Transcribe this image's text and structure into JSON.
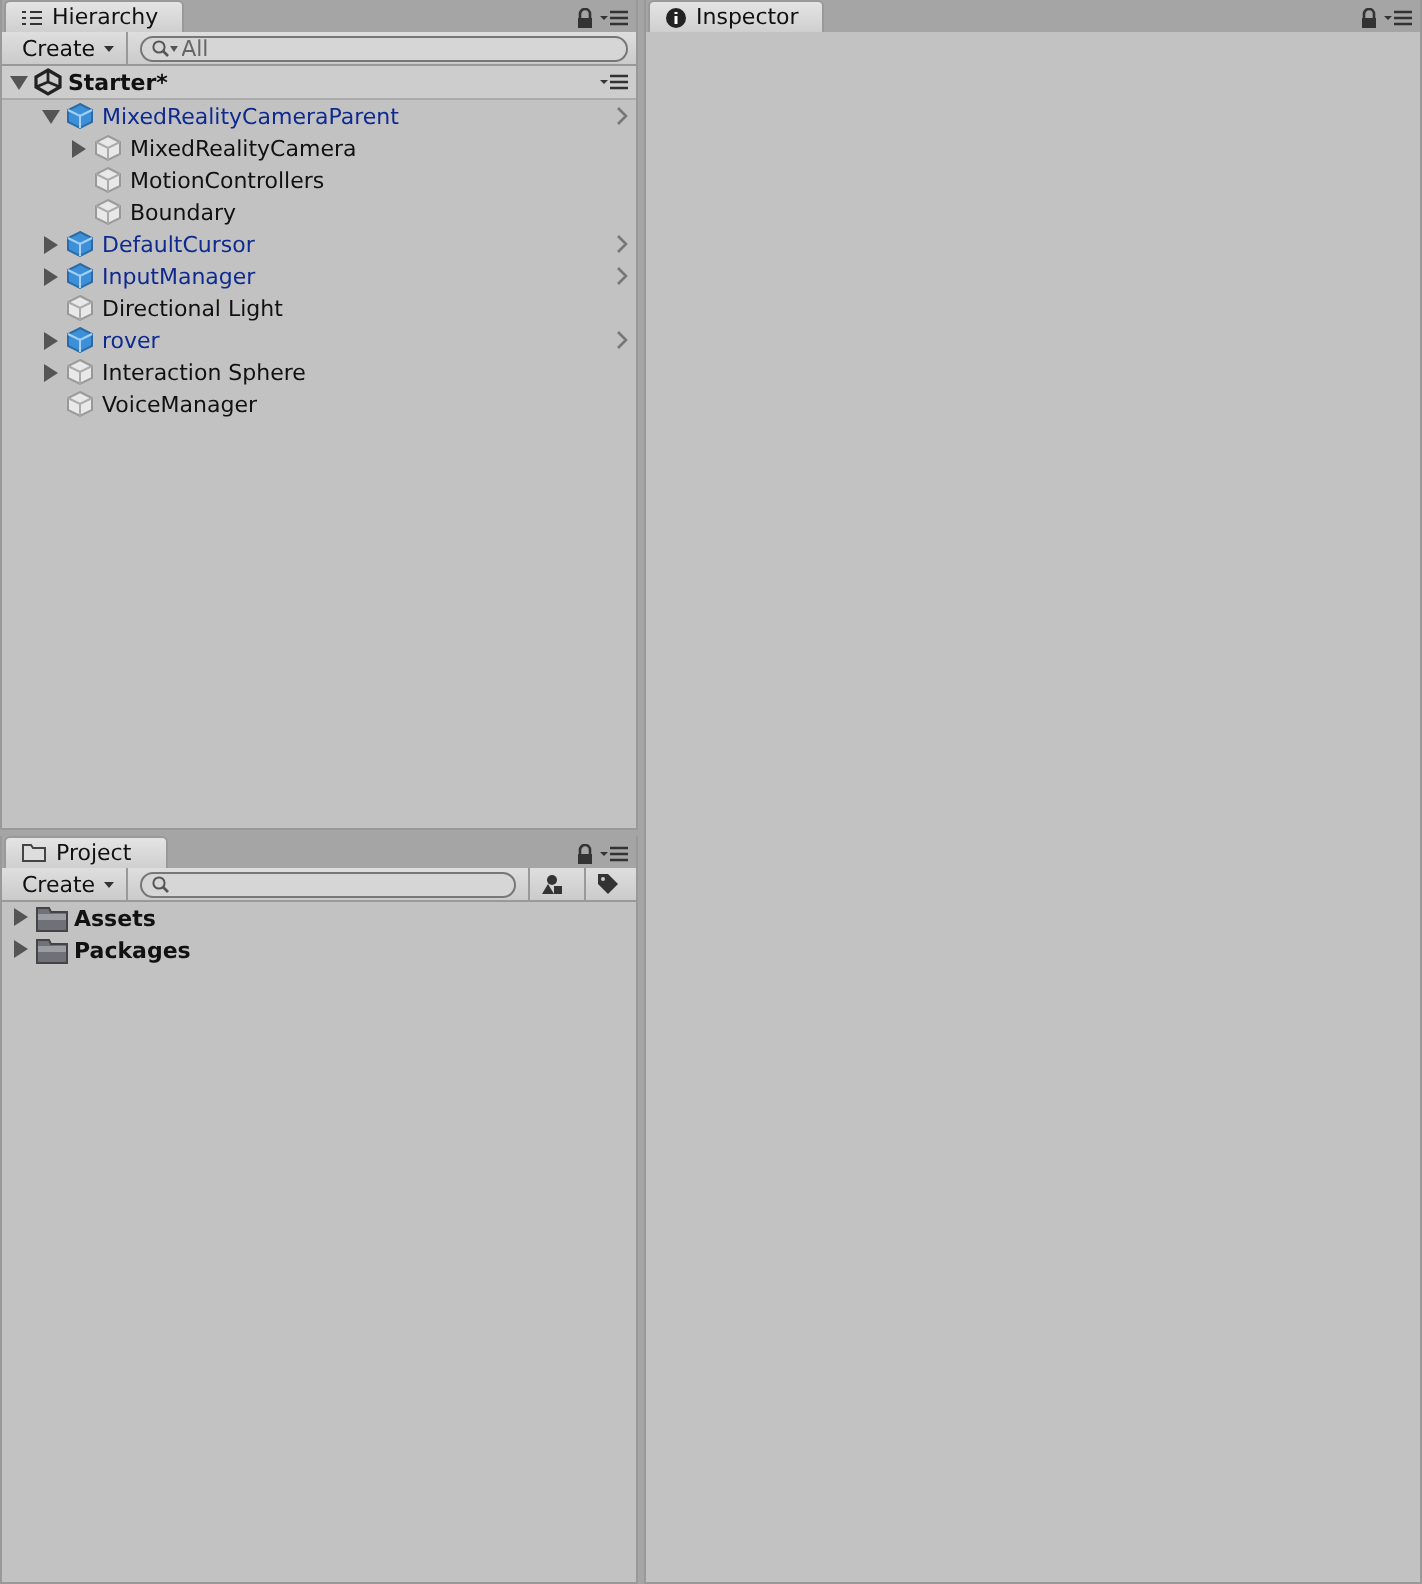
{
  "hierarchy": {
    "tab": "Hierarchy",
    "create": "Create",
    "search": {
      "placeholder": "All"
    },
    "scene": "Starter*",
    "items": [
      {
        "name": "MixedRealityCameraParent",
        "kind": "prefab",
        "expandable": true,
        "expanded": true,
        "children": [
          {
            "name": "MixedRealityCamera",
            "kind": "object",
            "expandable": true,
            "expanded": false
          },
          {
            "name": "MotionControllers",
            "kind": "object",
            "expandable": false,
            "expanded": false
          },
          {
            "name": "Boundary",
            "kind": "object",
            "expandable": false,
            "expanded": false
          }
        ]
      },
      {
        "name": "DefaultCursor",
        "kind": "prefab",
        "expandable": true,
        "expanded": false
      },
      {
        "name": "InputManager",
        "kind": "prefab",
        "expandable": true,
        "expanded": false
      },
      {
        "name": "Directional Light",
        "kind": "object",
        "expandable": false,
        "expanded": false
      },
      {
        "name": "rover",
        "kind": "prefab",
        "expandable": true,
        "expanded": false
      },
      {
        "name": "Interaction Sphere",
        "kind": "object",
        "expandable": true,
        "expanded": false
      },
      {
        "name": "VoiceManager",
        "kind": "object",
        "expandable": false,
        "expanded": false
      }
    ]
  },
  "project": {
    "tab": "Project",
    "create": "Create",
    "folders": [
      {
        "name": "Assets",
        "expanded": false
      },
      {
        "name": "Packages",
        "expanded": false
      }
    ]
  },
  "inspector": {
    "tab": "Inspector"
  }
}
